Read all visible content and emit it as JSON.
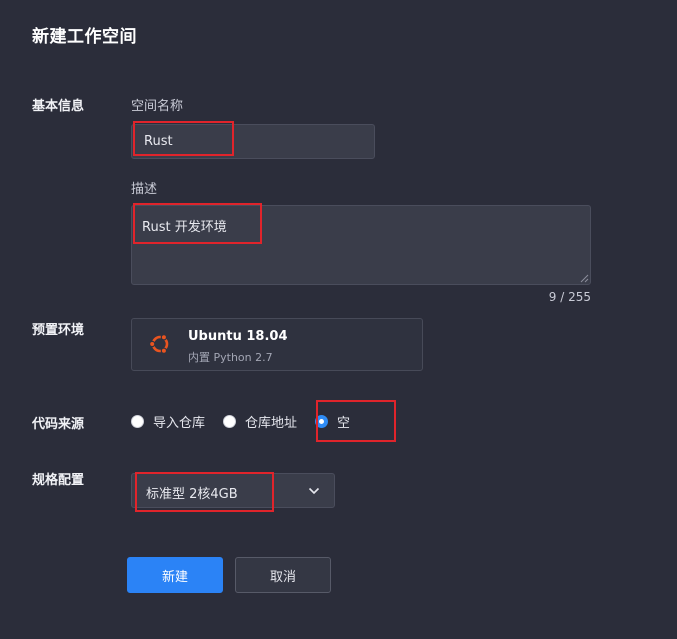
{
  "header": {
    "title": "新建工作空间"
  },
  "basic_info": {
    "section_label": "基本信息",
    "name_label": "空间名称",
    "name_value": "Rust",
    "desc_label": "描述",
    "desc_value": "Rust 开发环境",
    "char_count": "9 / 255"
  },
  "preset_env": {
    "section_label": "预置环境",
    "name": "Ubuntu 18.04",
    "subtitle": "内置 Python 2.7",
    "icon": "ubuntu-logo-icon"
  },
  "code_source": {
    "section_label": "代码来源",
    "options": [
      {
        "label": "导入仓库",
        "checked": false
      },
      {
        "label": "仓库地址",
        "checked": false
      },
      {
        "label": "空",
        "checked": true
      }
    ]
  },
  "spec": {
    "section_label": "规格配置",
    "selected": "标准型 2核4GB"
  },
  "actions": {
    "create_label": "新建",
    "cancel_label": "取消"
  },
  "colors": {
    "background": "#2b2d3a",
    "accent": "#2b83f6",
    "highlight": "#e0242b",
    "ubuntu": "#e95420"
  }
}
